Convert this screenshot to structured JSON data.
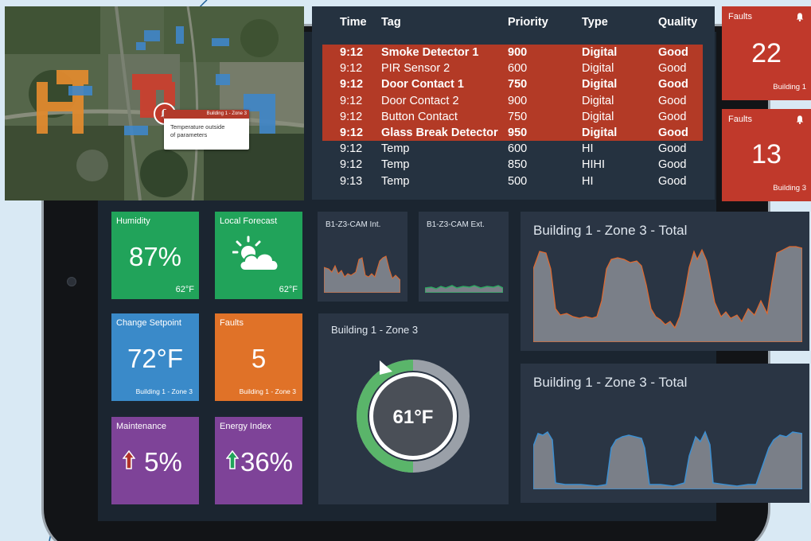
{
  "map": {
    "popup_header": "Building 1 - Zone 3",
    "popup_text_line1": "Temperature outside",
    "popup_text_line2": "of parameters"
  },
  "alarms": {
    "columns": [
      "Time",
      "Tag",
      "Priority",
      "Type",
      "Quality"
    ],
    "rows": [
      {
        "time": "9:12",
        "tag": "Smoke Detector 1",
        "priority": "900",
        "type": "Digital",
        "quality": "Good"
      },
      {
        "time": "9:12",
        "tag": "PIR Sensor 2",
        "priority": "600",
        "type": "Digital",
        "quality": "Good"
      },
      {
        "time": "9:12",
        "tag": "Door Contact 1",
        "priority": "750",
        "type": "Digital",
        "quality": "Good"
      },
      {
        "time": "9:12",
        "tag": "Door Contact 2",
        "priority": "900",
        "type": "Digital",
        "quality": "Good"
      },
      {
        "time": "9:12",
        "tag": "Button Contact",
        "priority": "750",
        "type": "Digital",
        "quality": "Good"
      },
      {
        "time": "9:12",
        "tag": "Glass Break Detector",
        "priority": "950",
        "type": "Digital",
        "quality": "Good"
      },
      {
        "time": "9:12",
        "tag": "Temp",
        "priority": "600",
        "type": "HI",
        "quality": "Good"
      },
      {
        "time": "9:12",
        "tag": "Temp",
        "priority": "850",
        "type": "HIHI",
        "quality": "Good"
      },
      {
        "time": "9:13",
        "tag": "Temp",
        "priority": "500",
        "type": "HI",
        "quality": "Good"
      }
    ]
  },
  "fault_tiles": [
    {
      "label": "Faults",
      "count": "22",
      "building": "Building 1"
    },
    {
      "label": "Faults",
      "count": "13",
      "building": "Building 3"
    }
  ],
  "tiles": {
    "humidity": {
      "title": "Humidity",
      "value": "87%",
      "foot": "62°F"
    },
    "forecast": {
      "title": "Local Forecast",
      "foot": "62°F",
      "icon": "partly-sunny-icon"
    },
    "setpoint": {
      "title": "Change Setpoint",
      "value": "72°F",
      "foot": "Building 1 - Zone 3"
    },
    "faults": {
      "title": "Faults",
      "value": "5",
      "foot": "Building 1 - Zone 3"
    },
    "maintenance": {
      "title": "Maintenance",
      "value": "5%",
      "icon": "arrow-up-icon"
    },
    "energy": {
      "title": "Energy Index",
      "value": "36%",
      "icon": "arrow-up-icon"
    }
  },
  "cams": [
    {
      "title": "B1-Z3-CAM Int."
    },
    {
      "title": "B1-Z3-CAM Ext."
    }
  ],
  "zone_panel": {
    "title": "Building 1 - Zone 3",
    "temp": "61°F",
    "gauge_fraction": 0.5
  },
  "trend_panels": [
    {
      "title": "Building 1 - Zone 3 - Total"
    },
    {
      "title": "Building 1 - Zone 3 - Total"
    }
  ],
  "colors": {
    "alarm_red": "#b33a26",
    "tile_green": "#21a35a",
    "tile_blue": "#3a8ac9",
    "tile_orange": "#e07228",
    "tile_purple": "#7e4398",
    "trend_line_1": "#e4692c",
    "trend_line_2": "#3d8fd1"
  }
}
